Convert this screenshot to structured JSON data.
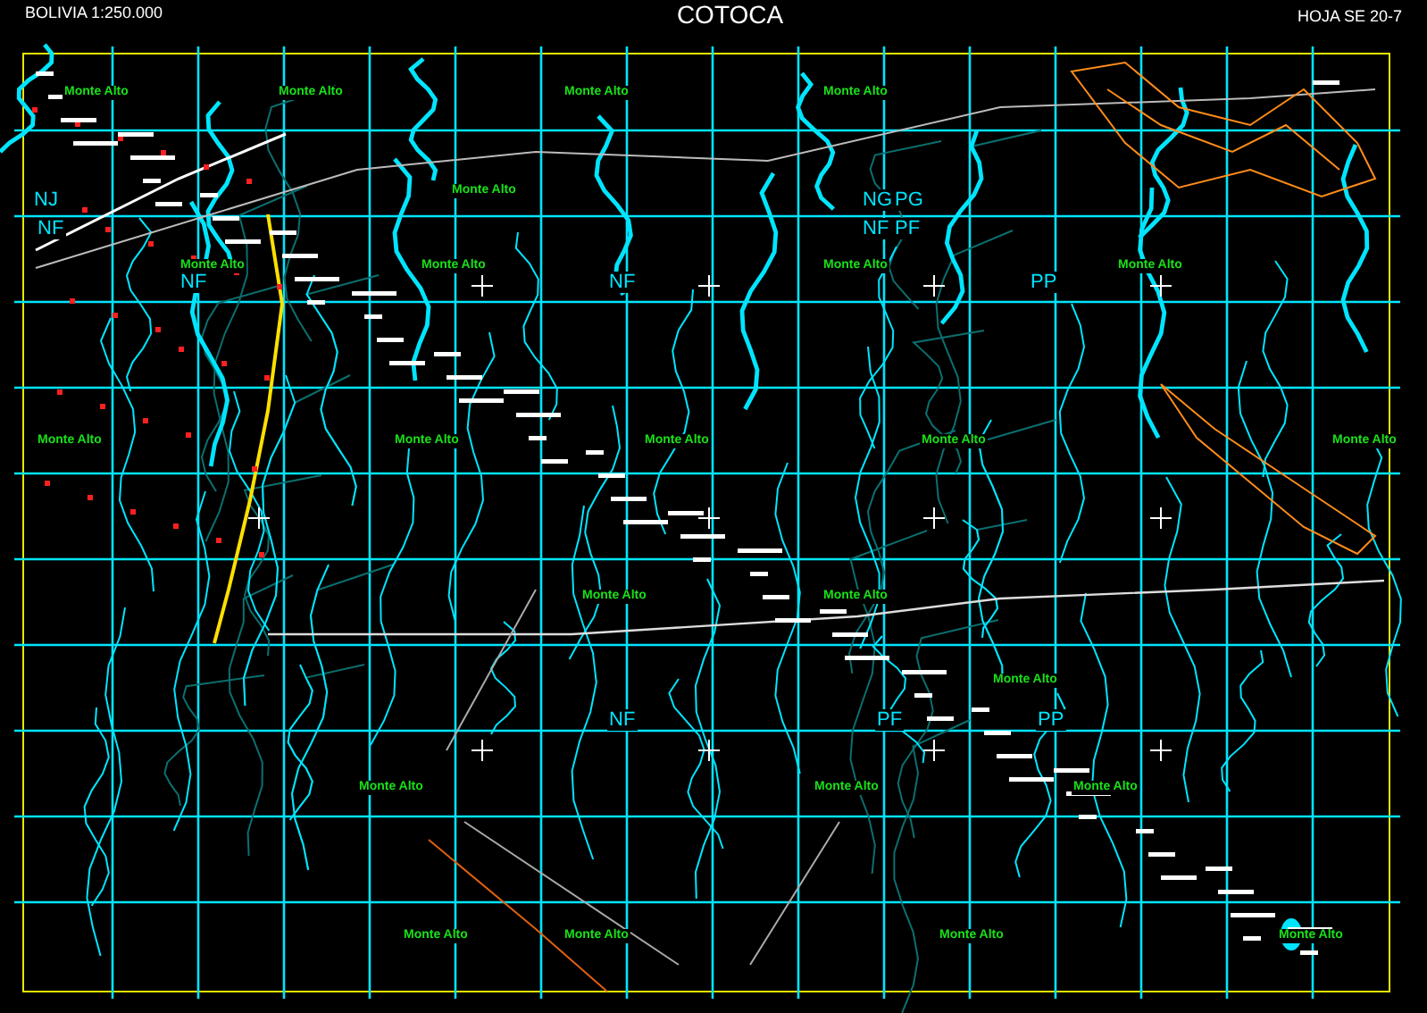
{
  "header": {
    "scale": "BOLIVIA 1:250.000",
    "title": "COTOCA",
    "sheet": "HOJA SE 20-7"
  },
  "map": {
    "zone_labels": [
      "NJ",
      "NG",
      "PG",
      "NF",
      "NF",
      "PF",
      "NF",
      "NF",
      "PP",
      "NF",
      "PF",
      "PP"
    ],
    "vegetation_labels": [
      "Monte Alto",
      "Monte Alto",
      "Monte Alto",
      "Monte Alto",
      "Monte Alto",
      "Monte Alto",
      "Monte Alto",
      "Monte Alto",
      "Monte Alto",
      "Monte Alto",
      "Monte Alto",
      "Monte Alto",
      "Monte Alto",
      "Monte Alto",
      "Monte Alto",
      "Monte Alto",
      "Monte Alto",
      "Monte Alto",
      "Monte Alto",
      "Monte Alto",
      "Monte Alto",
      "Monte Alto",
      "Monte Alto",
      "Monte Alto"
    ]
  }
}
